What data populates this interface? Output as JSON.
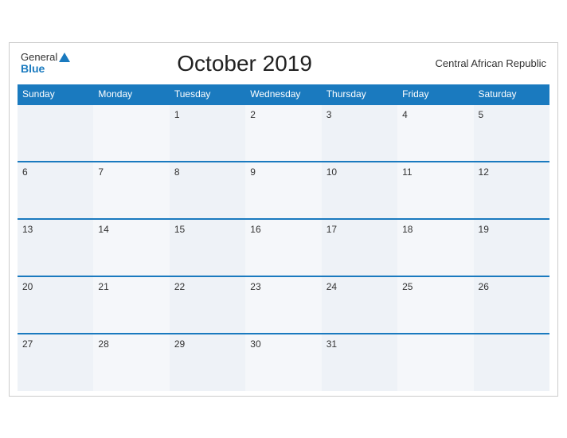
{
  "header": {
    "logo_general": "General",
    "logo_blue": "Blue",
    "title": "October 2019",
    "region": "Central African Republic"
  },
  "weekdays": [
    "Sunday",
    "Monday",
    "Tuesday",
    "Wednesday",
    "Thursday",
    "Friday",
    "Saturday"
  ],
  "weeks": [
    [
      "",
      "",
      "1",
      "2",
      "3",
      "4",
      "5"
    ],
    [
      "6",
      "7",
      "8",
      "9",
      "10",
      "11",
      "12"
    ],
    [
      "13",
      "14",
      "15",
      "16",
      "17",
      "18",
      "19"
    ],
    [
      "20",
      "21",
      "22",
      "23",
      "24",
      "25",
      "26"
    ],
    [
      "27",
      "28",
      "29",
      "30",
      "31",
      "",
      ""
    ]
  ]
}
